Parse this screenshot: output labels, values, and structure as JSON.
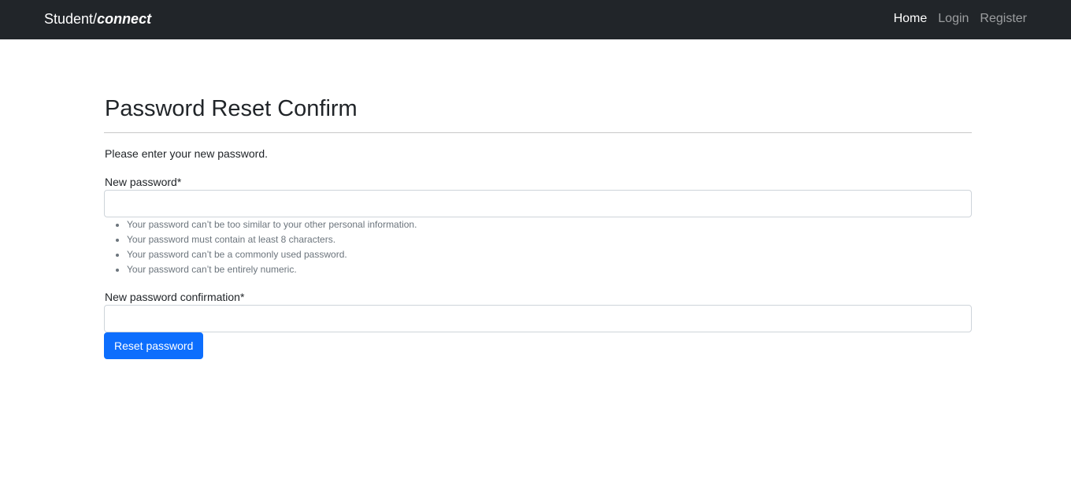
{
  "navbar": {
    "brand_prefix": "Student/",
    "brand_emphasis": "connect",
    "links": [
      {
        "label": "Home",
        "active": true
      },
      {
        "label": "Login",
        "active": false
      },
      {
        "label": "Register",
        "active": false
      }
    ]
  },
  "main": {
    "title": "Password Reset Confirm",
    "intro": "Please enter your new password.",
    "new_password": {
      "label": "New password*",
      "value": "",
      "help": [
        "Your password can’t be too similar to your other personal information.",
        "Your password must contain at least 8 characters.",
        "Your password can’t be a commonly used password.",
        "Your password can’t be entirely numeric."
      ]
    },
    "confirm_password": {
      "label": "New password confirmation*",
      "value": ""
    },
    "submit_label": "Reset password"
  },
  "colors": {
    "navbar_bg": "#212529",
    "primary": "#0d6efd",
    "muted_text": "#6c757d"
  }
}
